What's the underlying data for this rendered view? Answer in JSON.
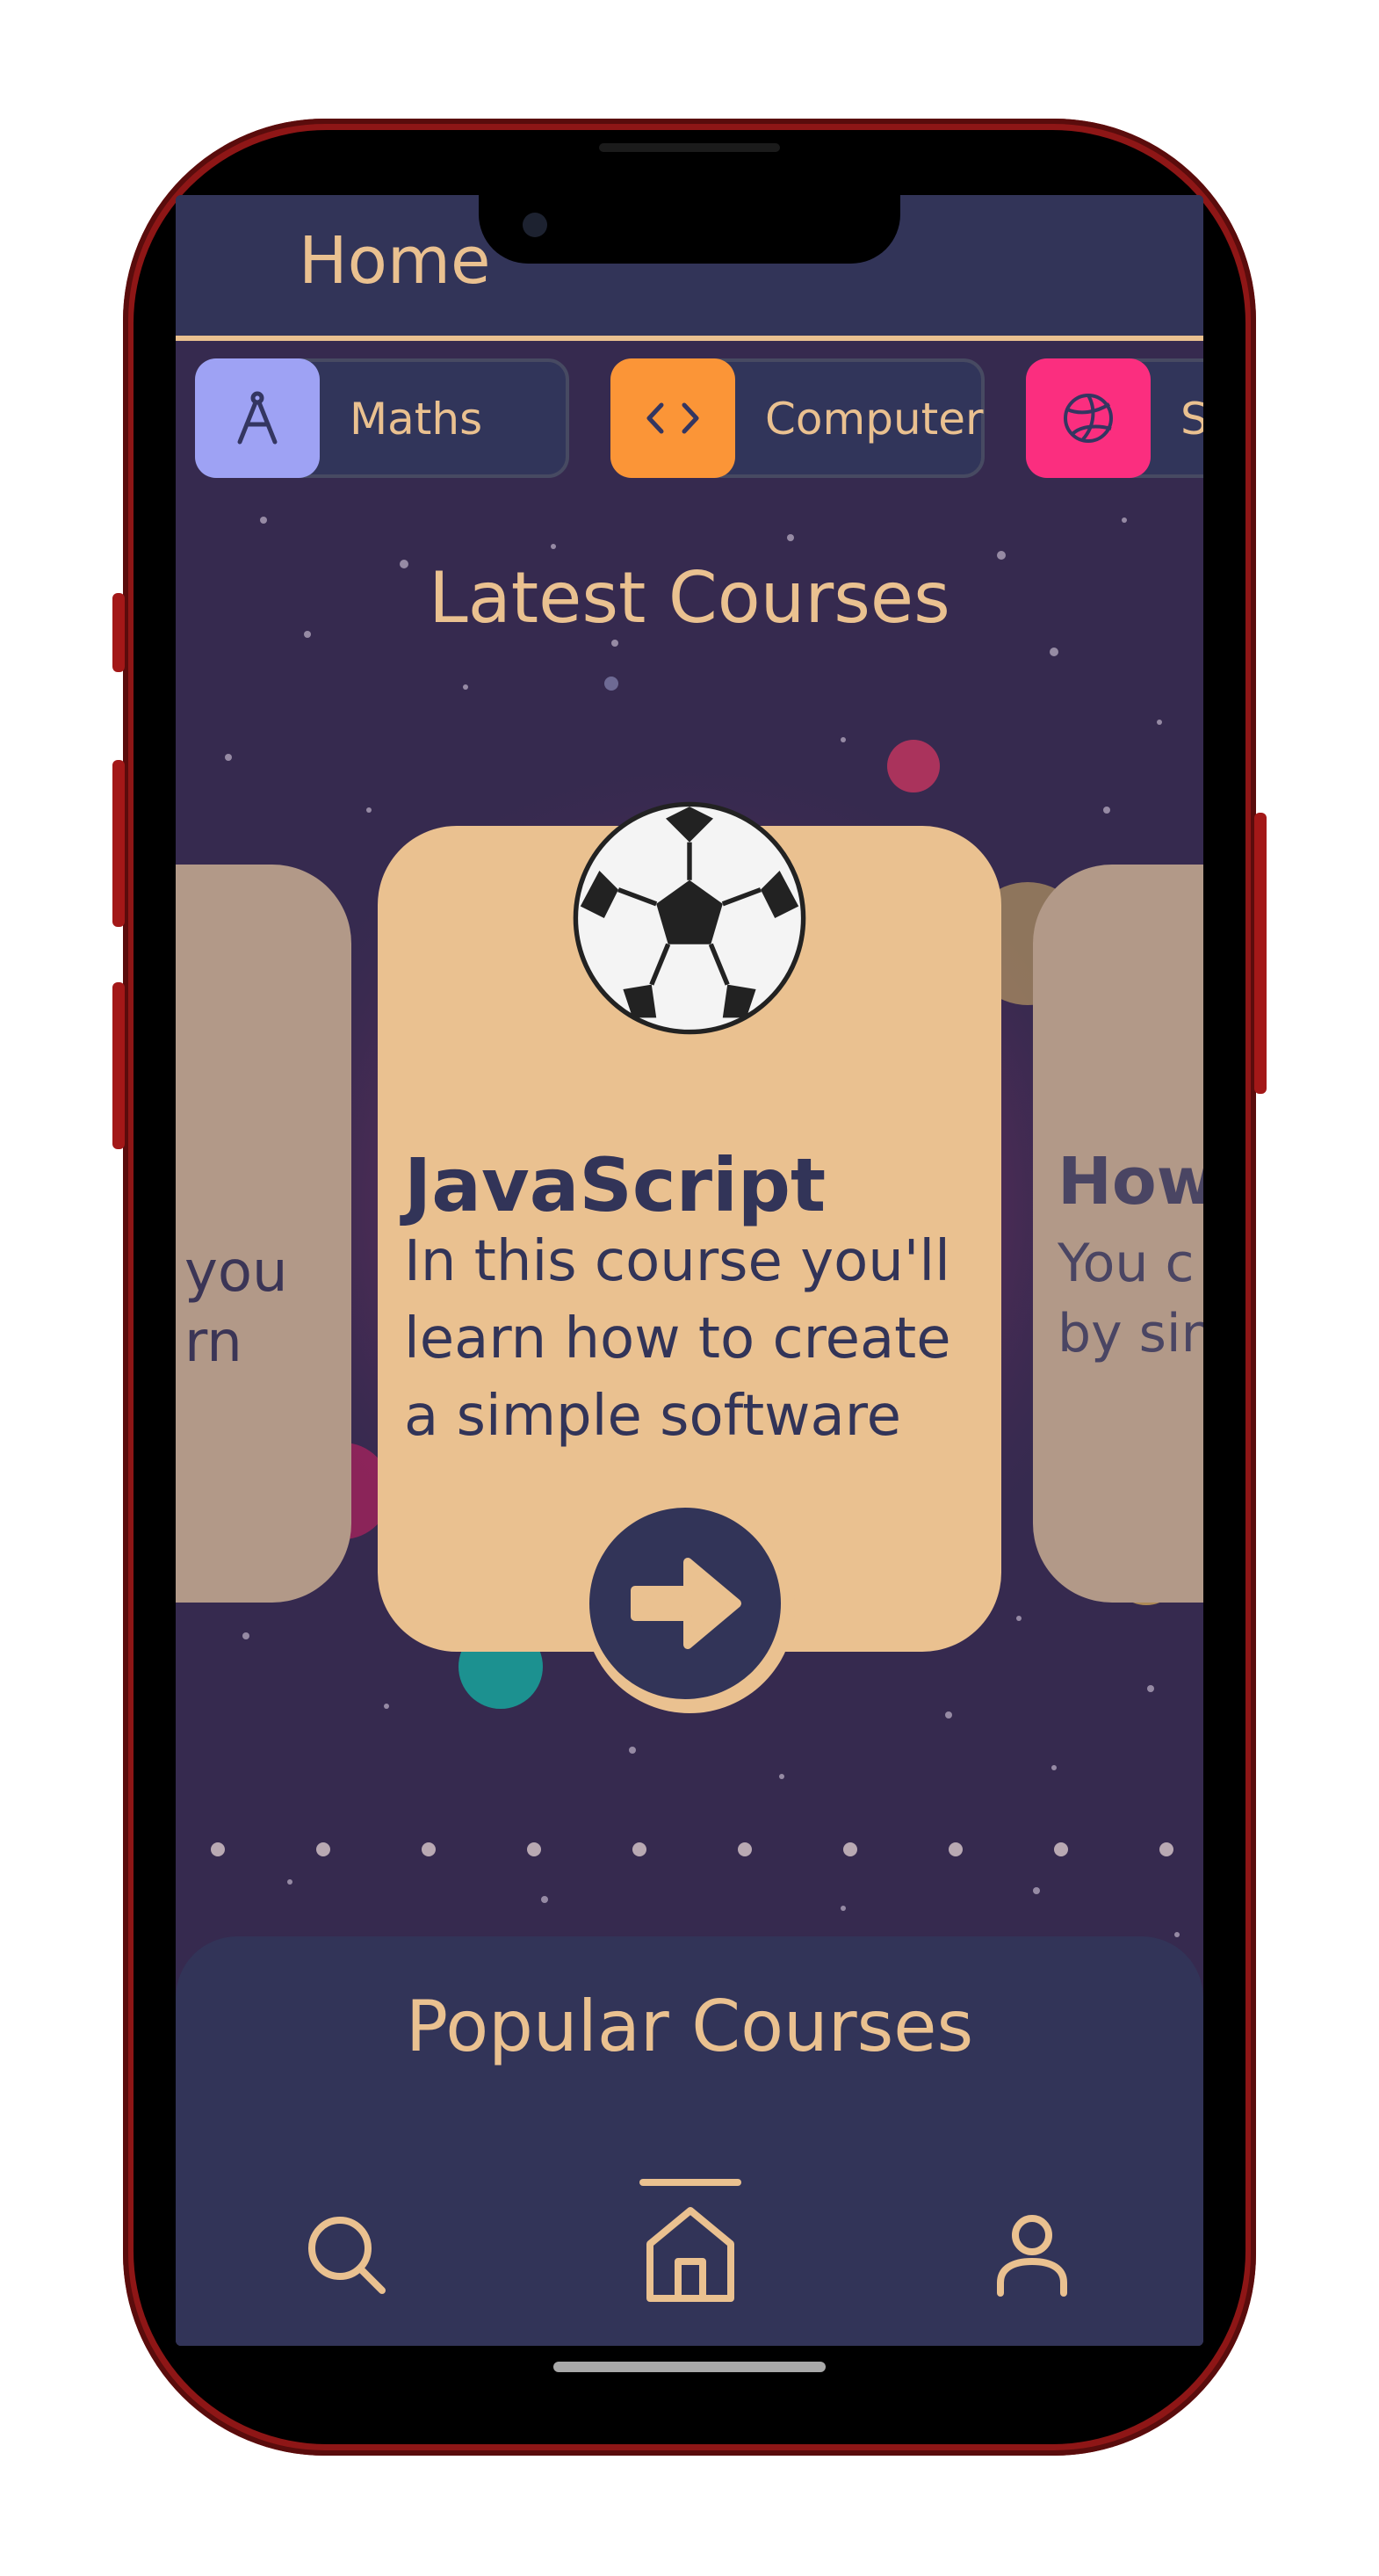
{
  "header": {
    "title": "Home"
  },
  "categories": [
    {
      "label": "Maths",
      "color": "#9ea2f4",
      "icon": "compass-icon"
    },
    {
      "label": "Computer",
      "color": "#fb9537",
      "icon": "code-icon"
    },
    {
      "label": "S",
      "color": "#fb2e7f",
      "icon": "volleyball-icon"
    }
  ],
  "sections": {
    "latest": "Latest Courses",
    "popular": "Popular Courses"
  },
  "courses": {
    "center": {
      "title": "JavaScript",
      "desc_line1": "In this course you'll",
      "desc_line2": "learn how to create",
      "desc_line3": "a simple software",
      "icon": "soccer-ball-icon"
    },
    "left": {
      "desc_line1": "you",
      "desc_line2": "rn"
    },
    "right": {
      "title": "How",
      "desc_line1": "You c",
      "desc_line2": "by sin"
    }
  },
  "nav": {
    "items": [
      "search",
      "home",
      "profile"
    ],
    "active": "home"
  },
  "colors": {
    "accent": "#eac190",
    "navy": "#323458",
    "space": "#362a4f"
  }
}
